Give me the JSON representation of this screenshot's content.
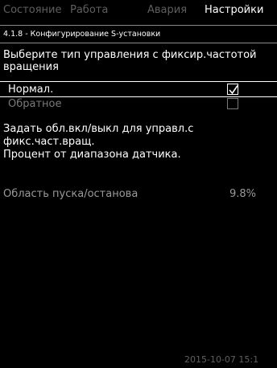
{
  "tabs": [
    {
      "label": "Состояние",
      "active": false
    },
    {
      "label": "Работа",
      "active": false
    },
    {
      "label": "Авария",
      "active": false
    },
    {
      "label": "Настройки",
      "active": true
    }
  ],
  "menu_id": "4.1.8 - Конфигурирование S-установки",
  "question": "Выберите тип управления с фиксир.частотой вращения",
  "options": [
    {
      "label": "Нормал.",
      "checked": true
    },
    {
      "label": "Обратное",
      "checked": false
    }
  ],
  "info": {
    "line1": "Задать обл.вкл/выкл для управл.с",
    "line2": "фикс.част.вращ.",
    "line3": "Процент от диапазона датчика."
  },
  "setting": {
    "label": "Область пуска/останова",
    "value": "9.8%"
  },
  "timestamp": "2015-10-07 15:1",
  "colors": {
    "background": "#000000",
    "text": "#ffffff",
    "inactive_tab": "#5f5f5f",
    "dim": "#7a7a7a"
  }
}
